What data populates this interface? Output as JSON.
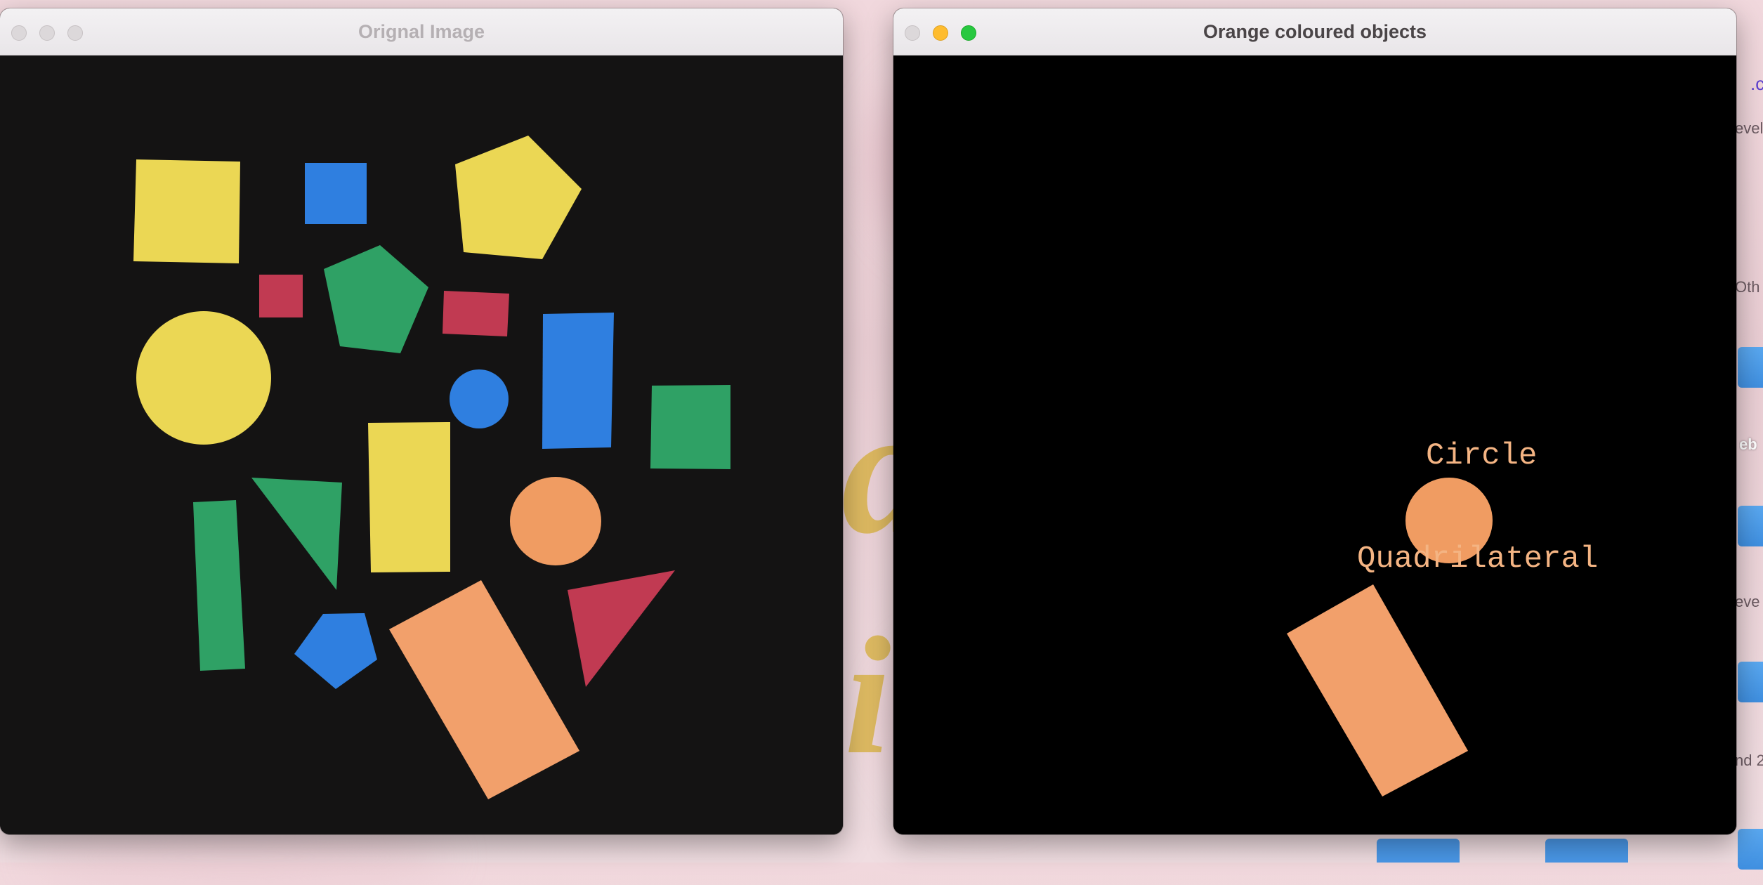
{
  "colors": {
    "yellow": "#ebd754",
    "blue": "#2f7fe0",
    "green": "#2fa165",
    "red": "#c13a52",
    "orange": "#f09c62",
    "label": "#f4b483"
  },
  "windows": [
    {
      "title": "Orignal Image",
      "focused": false
    },
    {
      "title": "Orange coloured objects",
      "focused": true
    }
  ],
  "detections": {
    "circle_label": "Circle",
    "quad_label": "Quadrilateral"
  },
  "background_fragments": {
    "s1": ".c",
    "s2": "evel",
    "s3": "Oth",
    "s4": "eb",
    "s5": "eve",
    "s6": "nd 2"
  },
  "icons": [
    "close-icon",
    "minimize-icon",
    "zoom-icon",
    "folder-icon"
  ]
}
